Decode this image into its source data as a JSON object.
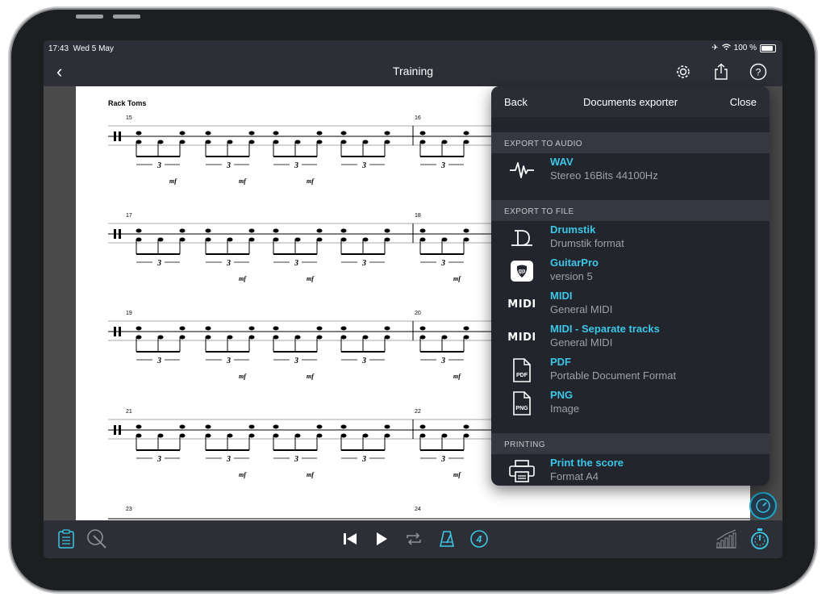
{
  "status": {
    "time": "17:43",
    "date": "Wed 5 May",
    "battery": "100 %"
  },
  "nav": {
    "title": "Training",
    "back_icon": "chevron-left-icon"
  },
  "score": {
    "instrument": "Rack Toms",
    "measures": [
      "15",
      "16",
      "17",
      "18",
      "19",
      "20",
      "21",
      "22",
      "23",
      "24"
    ],
    "triplet_label": "3",
    "dynamic": "mf"
  },
  "exporter": {
    "back_label": "Back",
    "title": "Documents exporter",
    "close_label": "Close",
    "sections": [
      {
        "label": "EXPORT TO AUDIO"
      },
      {
        "label": "EXPORT TO FILE"
      },
      {
        "label": "PRINTING"
      }
    ],
    "items": [
      {
        "title": "WAV",
        "subtitle": "Stereo 16Bits 44100Hz",
        "icon": "waveform-icon"
      },
      {
        "title": "Drumstik",
        "subtitle": "Drumstik format",
        "icon": "drumstik-logo-icon"
      },
      {
        "title": "GuitarPro",
        "subtitle": "version 5",
        "icon": "guitarpro-icon"
      },
      {
        "title": "MIDI",
        "subtitle": "General MIDI",
        "icon": "midi-icon"
      },
      {
        "title": "MIDI - Separate tracks",
        "subtitle": "General MIDI",
        "icon": "midi-icon"
      },
      {
        "title": "PDF",
        "subtitle": "Portable Document Format",
        "icon": "pdf-file-icon"
      },
      {
        "title": "PNG",
        "subtitle": "Image",
        "icon": "png-file-icon"
      },
      {
        "title": "Print the score",
        "subtitle": "Format A4",
        "icon": "printer-icon"
      }
    ],
    "midi_glyph": "MIDI",
    "gp_glyph": "gp",
    "pdf_glyph": "PDF",
    "png_glyph": "PNG"
  },
  "colors": {
    "accent": "#3cc7e8",
    "panel": "#22252c",
    "bar": "#2c2f36"
  }
}
